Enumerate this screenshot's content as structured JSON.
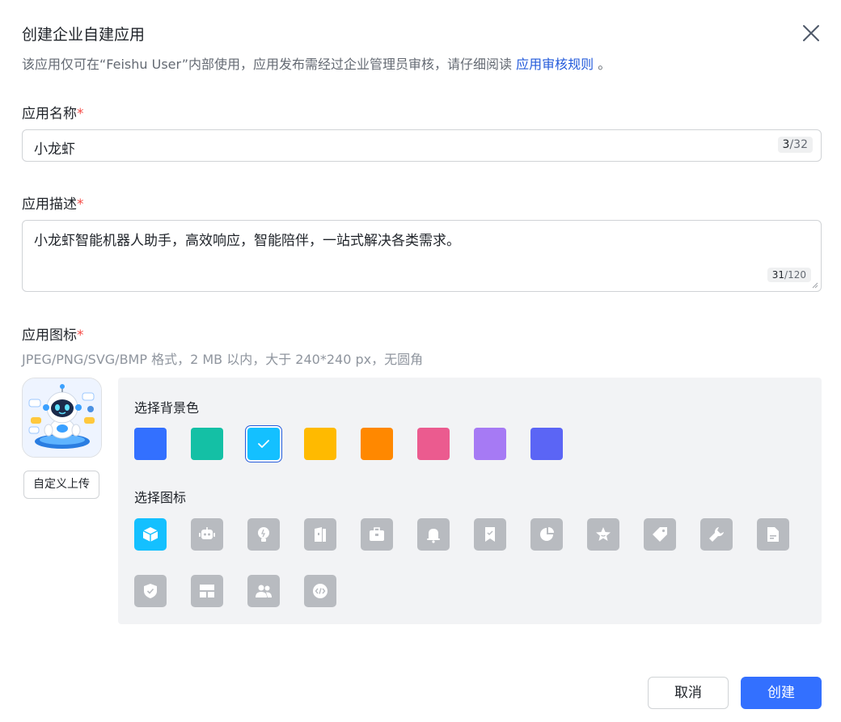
{
  "dialog": {
    "title": "创建企业自建应用",
    "subtitle_prefix": "该应用仅可在“Feishu User”内部使用，应用发布需经过企业管理员审核，请仔细阅读 ",
    "subtitle_link": "应用审核规则",
    "subtitle_suffix": " 。"
  },
  "form": {
    "name": {
      "label": "应用名称",
      "required_mark": "*",
      "value": "小龙虾",
      "count_current": "3",
      "count_max": "/32"
    },
    "description": {
      "label": "应用描述",
      "required_mark": "*",
      "value": "小龙虾智能机器人助手，高效响应，智能陪伴，一站式解决各类需求。",
      "count_current": "31",
      "count_max": "/120"
    },
    "icon": {
      "label": "应用图标",
      "required_mark": "*",
      "hint": "JPEG/PNG/SVG/BMP 格式，2 MB 以内，大于 240*240 px，无圆角",
      "upload_label": "自定义上传",
      "background_label": "选择背景色",
      "icon_label": "选择图标",
      "selected_color_index": 2,
      "selected_icon_index": 0,
      "colors": [
        "#3370ff",
        "#14c0a5",
        "#14c0ff",
        "#ffba00",
        "#ff8800",
        "#eb5b8f",
        "#a67af4",
        "#5b65f5"
      ],
      "icons": [
        "cube-icon",
        "robot-icon",
        "lightbulb-icon",
        "book-icon",
        "briefcase-icon",
        "bell-icon",
        "bookmark-check-icon",
        "pie-chart-icon",
        "star-icon",
        "tag-icon",
        "wrench-icon",
        "document-icon",
        "shield-check-icon",
        "layout-icon",
        "users-icon",
        "code-icon"
      ]
    }
  },
  "footer": {
    "cancel_label": "取消",
    "create_label": "创建"
  }
}
